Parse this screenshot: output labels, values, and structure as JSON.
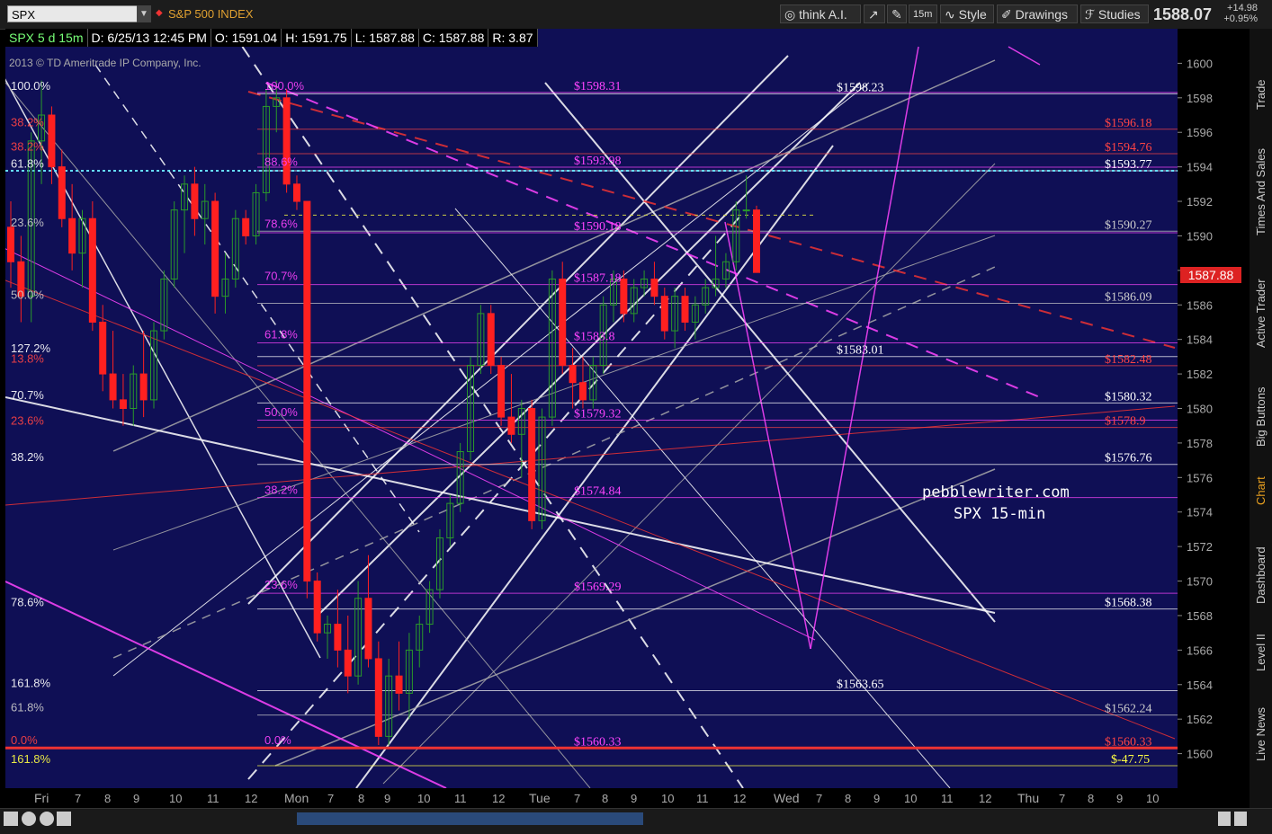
{
  "toolbar": {
    "symbol": "SPX",
    "symbol_name": "S&P 500 INDEX",
    "think_ai": "think A.I.",
    "timeframe": "15m",
    "style": "Style",
    "drawings": "Drawings",
    "studies": "Studies",
    "last_price": "1588.07",
    "change": "+14.98",
    "change_pct": "+0.95%"
  },
  "infobar": {
    "symbol_desc": "SPX 5 d 15m",
    "date": "D: 6/25/13 12:45 PM",
    "open": "O: 1591.04",
    "high": "H: 1591.75",
    "low": "L: 1587.88",
    "close": "C: 1587.88",
    "range": "R: 3.87"
  },
  "copyright": "2013 © TD Ameritrade IP Company, Inc.",
  "watermark": {
    "line1": "pebblewriter.com",
    "line2": "SPX 15-min"
  },
  "current_price_tag": "1587.88",
  "sidebar_tabs": [
    "Trade",
    "Times And Sales",
    "Active Trader",
    "Big Buttons",
    "Chart",
    "Dashboard",
    "Level II",
    "Live News"
  ],
  "colors": {
    "background": "#0f0f55",
    "up": "#2a9a2a",
    "down": "#ff2020",
    "magenta": "#ff44ff",
    "red_line": "#ee3333",
    "cyan": "#66ddff"
  },
  "chart_data": {
    "type": "candlestick",
    "ylim": [
      1558,
      1602
    ],
    "yticks": [
      1560,
      1562,
      1564,
      1566,
      1568,
      1570,
      1572,
      1574,
      1576,
      1578,
      1580,
      1582,
      1584,
      1586,
      1588,
      1590,
      1592,
      1594,
      1596,
      1598,
      1600
    ],
    "xtick_labels": [
      "Fri",
      "7",
      "8",
      "9",
      "10",
      "11",
      "12",
      "Mon",
      "7",
      "8",
      "9",
      "10",
      "11",
      "12",
      "Tue",
      "7",
      "8",
      "9",
      "10",
      "11",
      "12",
      "Wed",
      "7",
      "8",
      "9",
      "10",
      "11",
      "12",
      "Thu",
      "7",
      "8",
      "9",
      "10"
    ],
    "candles": [
      [
        1590.5,
        1592,
        1587,
        1588.5
      ],
      [
        1588.5,
        1590,
        1585,
        1586.5
      ],
      [
        1586.5,
        1596,
        1585,
        1595.5
      ],
      [
        1595.5,
        1599,
        1593,
        1597
      ],
      [
        1597,
        1597.5,
        1593,
        1594
      ],
      [
        1594,
        1595,
        1590.5,
        1591
      ],
      [
        1591,
        1593,
        1588,
        1589
      ],
      [
        1589,
        1591.5,
        1587,
        1591
      ],
      [
        1591,
        1592,
        1584.5,
        1585
      ],
      [
        1585,
        1586,
        1581,
        1582
      ],
      [
        1582,
        1584.5,
        1580,
        1580.5
      ],
      [
        1580.5,
        1582,
        1579,
        1580
      ],
      [
        1580,
        1582.5,
        1579,
        1582
      ],
      [
        1582,
        1584.5,
        1579.5,
        1580.5
      ],
      [
        1580.5,
        1585,
        1580,
        1584.5
      ],
      [
        1584.5,
        1588,
        1584,
        1587.5
      ],
      [
        1587.5,
        1592,
        1587,
        1591.5
      ],
      [
        1591.5,
        1593.5,
        1589,
        1593
      ],
      [
        1593,
        1594,
        1590,
        1591
      ],
      [
        1591,
        1593,
        1589.5,
        1592
      ],
      [
        1592,
        1592.5,
        1585.5,
        1586.5
      ],
      [
        1586.5,
        1589,
        1585.5,
        1587.5
      ],
      [
        1587.5,
        1591.5,
        1587,
        1591
      ],
      [
        1591,
        1591.5,
        1589.5,
        1590
      ],
      [
        1590,
        1593,
        1589.5,
        1592.5
      ],
      [
        1592.5,
        1598.5,
        1592,
        1597.5
      ],
      [
        1597.5,
        1599,
        1596,
        1598
      ],
      [
        1598,
        1598.5,
        1592.5,
        1593
      ],
      [
        1593,
        1593.5,
        1591.5,
        1592
      ],
      [
        1592,
        1592,
        1569,
        1570
      ],
      [
        1570,
        1570.5,
        1566.5,
        1567
      ],
      [
        1567,
        1568,
        1565.5,
        1567.5
      ],
      [
        1567.5,
        1569.5,
        1565,
        1566
      ],
      [
        1566,
        1568,
        1563.5,
        1564.5
      ],
      [
        1564.5,
        1570,
        1564,
        1569
      ],
      [
        1569,
        1571.5,
        1565,
        1565.5
      ],
      [
        1565.5,
        1566.5,
        1560.5,
        1561
      ],
      [
        1561,
        1565.5,
        1560.5,
        1564.5
      ],
      [
        1564.5,
        1566.5,
        1562.5,
        1563.5
      ],
      [
        1563.5,
        1567,
        1562,
        1566
      ],
      [
        1566,
        1568,
        1565,
        1567.5
      ],
      [
        1567.5,
        1570,
        1567,
        1569.5
      ],
      [
        1569.5,
        1573,
        1569,
        1572.5
      ],
      [
        1572.5,
        1575,
        1572,
        1574.5
      ],
      [
        1574.5,
        1578,
        1574,
        1577.5
      ],
      [
        1577.5,
        1583,
        1577,
        1582.5
      ],
      [
        1582.5,
        1586,
        1582,
        1585.5
      ],
      [
        1585.5,
        1586,
        1582,
        1582.5
      ],
      [
        1582.5,
        1583,
        1579,
        1579.5
      ],
      [
        1579.5,
        1582,
        1578,
        1578.5
      ],
      [
        1578.5,
        1580.5,
        1576,
        1580
      ],
      [
        1580,
        1580.5,
        1573,
        1573.5
      ],
      [
        1573.5,
        1580,
        1573,
        1579.5
      ],
      [
        1579.5,
        1588,
        1579,
        1587.5
      ],
      [
        1587.5,
        1588.5,
        1582,
        1582.5
      ],
      [
        1582.5,
        1583.5,
        1580,
        1581.5
      ],
      [
        1581.5,
        1583,
        1580,
        1580.5
      ],
      [
        1580.5,
        1583,
        1580,
        1582.5
      ],
      [
        1582.5,
        1586.5,
        1582,
        1586
      ],
      [
        1586,
        1588,
        1585,
        1587.5
      ],
      [
        1587.5,
        1588,
        1585,
        1585.5
      ],
      [
        1585.5,
        1587.5,
        1585,
        1587
      ],
      [
        1587,
        1588,
        1586.5,
        1587.5
      ],
      [
        1587.5,
        1588.5,
        1586,
        1586.5
      ],
      [
        1586.5,
        1587,
        1584,
        1584.5
      ],
      [
        1584.5,
        1587,
        1583.5,
        1586.5
      ],
      [
        1586.5,
        1587,
        1584.5,
        1585
      ],
      [
        1585,
        1586.5,
        1584,
        1586
      ],
      [
        1586,
        1587.5,
        1585.5,
        1587
      ],
      [
        1587,
        1590,
        1586.5,
        1587.5
      ],
      [
        1587.5,
        1589,
        1587,
        1588.5
      ],
      [
        1588.5,
        1592,
        1588,
        1591.5
      ],
      [
        1591.5,
        1593.5,
        1591,
        1591.5
      ],
      [
        1591.5,
        1591.75,
        1587.88,
        1587.88
      ]
    ],
    "levels": [
      {
        "y": 1598.31,
        "label": "$1598.31",
        "color": "#ff44ff"
      },
      {
        "y": 1598.23,
        "label": "$1598.23",
        "color": "#ffffff"
      },
      {
        "y": 1596.18,
        "label": "$1596.18",
        "color": "#ff4444"
      },
      {
        "y": 1594.76,
        "label": "$1594.76",
        "color": "#ff4444"
      },
      {
        "y": 1593.98,
        "label": "$1593.98",
        "color": "#ff44ff"
      },
      {
        "y": 1593.77,
        "label": "$1593.77",
        "color": "#ffffff"
      },
      {
        "y": 1590.27,
        "label": "$1590.27",
        "color": "#cccccc"
      },
      {
        "y": 1590.18,
        "label": "$1590.18",
        "color": "#ff44ff"
      },
      {
        "y": 1587.18,
        "label": "$1587.18",
        "color": "#ff44ff"
      },
      {
        "y": 1586.09,
        "label": "$1586.09",
        "color": "#cccccc"
      },
      {
        "y": 1583.8,
        "label": "$1583.8",
        "color": "#ff44ff"
      },
      {
        "y": 1583.01,
        "label": "$1583.01",
        "color": "#ffffff"
      },
      {
        "y": 1582.48,
        "label": "$1582.48",
        "color": "#ff4444"
      },
      {
        "y": 1580.32,
        "label": "$1580.32",
        "color": "#ffffff"
      },
      {
        "y": 1579.32,
        "label": "$1579.32",
        "color": "#ff44ff"
      },
      {
        "y": 1578.9,
        "label": "$1578.9",
        "color": "#ff4444"
      },
      {
        "y": 1576.76,
        "label": "$1576.76",
        "color": "#ffffff"
      },
      {
        "y": 1574.84,
        "label": "$1574.84",
        "color": "#ff44ff"
      },
      {
        "y": 1569.29,
        "label": "$1569.29",
        "color": "#ff44ff"
      },
      {
        "y": 1568.38,
        "label": "$1568.38",
        "color": "#ffffff"
      },
      {
        "y": 1563.65,
        "label": "$1563.65",
        "color": "#ffffff"
      },
      {
        "y": 1562.24,
        "label": "$1562.24",
        "color": "#cccccc"
      },
      {
        "y": 1560.33,
        "label": "$1560.33",
        "color": "#ff4444"
      },
      {
        "y": 1560.33,
        "label": "$1560.33",
        "color": "#ff44ff"
      },
      {
        "y": 1559.3,
        "label": "$-47.75",
        "color": "#ffff44"
      }
    ],
    "fib_labels": [
      {
        "text": "100.0%",
        "y": 1598.3,
        "color": "#ffffff"
      },
      {
        "text": "100.0%",
        "y": 1598.3,
        "color": "#ff44ff"
      },
      {
        "text": "38.2%",
        "y": 1596.2,
        "color": "#ff4444"
      },
      {
        "text": "38.2%",
        "y": 1594.8,
        "color": "#ff4444"
      },
      {
        "text": "61.8%",
        "y": 1593.8,
        "color": "#ffffff"
      },
      {
        "text": "88.6%",
        "y": 1593.9,
        "color": "#ff44ff"
      },
      {
        "text": "23.6%",
        "y": 1590.4,
        "color": "#cccccc"
      },
      {
        "text": "78.6%",
        "y": 1590.3,
        "color": "#ff44ff"
      },
      {
        "text": "70.7%",
        "y": 1587.3,
        "color": "#ff44ff"
      },
      {
        "text": "50.0%",
        "y": 1586.2,
        "color": "#cccccc"
      },
      {
        "text": "61.8%",
        "y": 1583.9,
        "color": "#ff44ff"
      },
      {
        "text": "127.2%",
        "y": 1583.1,
        "color": "#ffffff"
      },
      {
        "text": "13.8%",
        "y": 1582.5,
        "color": "#ff4444"
      },
      {
        "text": "70.7%",
        "y": 1580.4,
        "color": "#ffffff"
      },
      {
        "text": "50.0%",
        "y": 1579.4,
        "color": "#ff44ff"
      },
      {
        "text": "23.6%",
        "y": 1578.9,
        "color": "#ff4444"
      },
      {
        "text": "38.2%",
        "y": 1576.8,
        "color": "#ffffff"
      },
      {
        "text": "38.2%",
        "y": 1574.9,
        "color": "#ff44ff"
      },
      {
        "text": "23.6%",
        "y": 1569.4,
        "color": "#ff44ff"
      },
      {
        "text": "78.6%",
        "y": 1568.4,
        "color": "#ffffff"
      },
      {
        "text": "161.8%",
        "y": 1563.7,
        "color": "#ffffff"
      },
      {
        "text": "61.8%",
        "y": 1562.3,
        "color": "#cccccc"
      },
      {
        "text": "0.0%",
        "y": 1560.4,
        "color": "#ff4444"
      },
      {
        "text": "0.0%",
        "y": 1560.4,
        "color": "#ff44ff"
      },
      {
        "text": "161.8%",
        "y": 1559.3,
        "color": "#ffff44"
      }
    ]
  }
}
